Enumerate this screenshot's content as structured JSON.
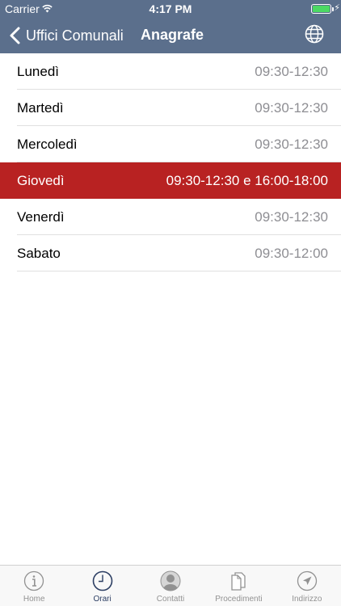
{
  "status_bar": {
    "carrier": "Carrier",
    "time": "4:17 PM"
  },
  "nav": {
    "back_label": "Uffici Comunali",
    "title": "Anagrafe",
    "accent": "#5b6f8c"
  },
  "schedule": [
    {
      "day": "Lunedì",
      "hours": "09:30-12:30"
    },
    {
      "day": "Martedì",
      "hours": "09:30-12:30"
    },
    {
      "day": "Mercoledì",
      "hours": "09:30-12:30"
    },
    {
      "day": "Giovedì",
      "hours": "09:30-12:30 e 16:00-18:00",
      "highlighted": true
    },
    {
      "day": "Venerdì",
      "hours": "09:30-12:30"
    },
    {
      "day": "Sabato",
      "hours": "09:30-12:00"
    }
  ],
  "highlight_color": "#b82222",
  "tabs": [
    {
      "label": "Home",
      "icon": "info-icon"
    },
    {
      "label": "Orari",
      "icon": "clock-icon",
      "selected": true
    },
    {
      "label": "Contatti",
      "icon": "person-icon"
    },
    {
      "label": "Procedimenti",
      "icon": "documents-icon"
    },
    {
      "label": "Indirizzo",
      "icon": "location-arrow-icon"
    }
  ]
}
